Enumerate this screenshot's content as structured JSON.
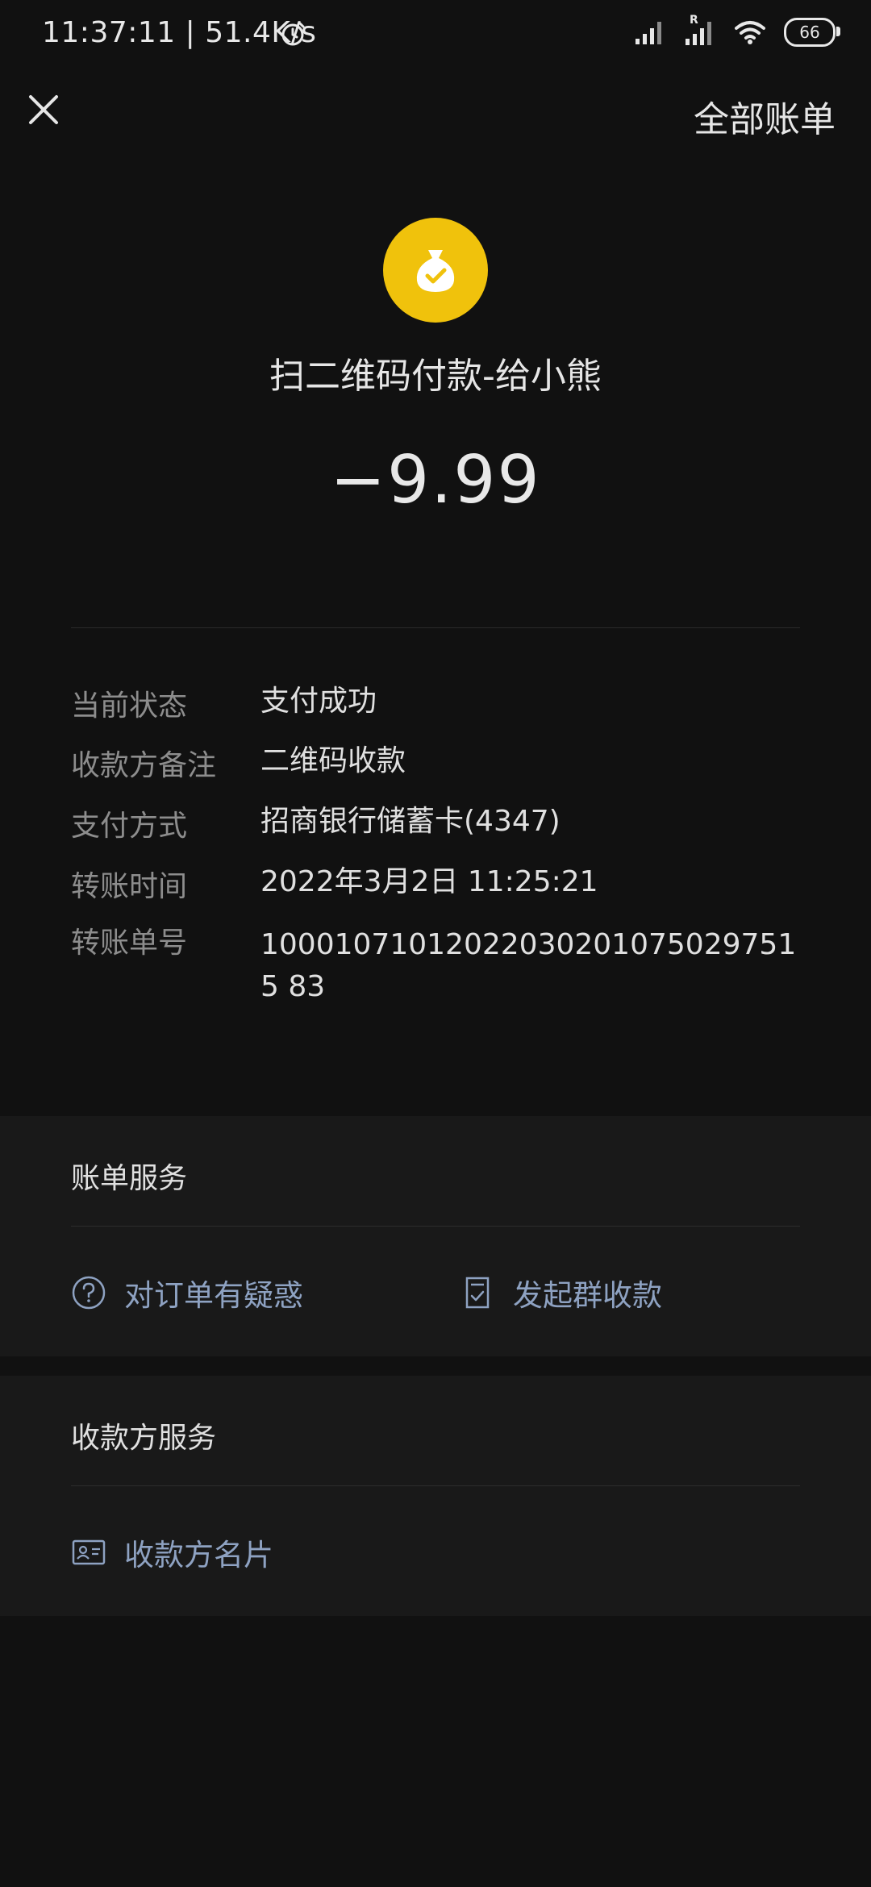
{
  "status_bar": {
    "time": "11:37:11 | 51.4K/s",
    "battery": "66",
    "roaming_mark": "R"
  },
  "nav": {
    "right_label": "全部账单"
  },
  "header": {
    "title": "扫二维码付款-给小熊",
    "amount": "−9.99"
  },
  "details": [
    {
      "label": "当前状态",
      "value": "支付成功"
    },
    {
      "label": "收款方备注",
      "value": "二维码收款"
    },
    {
      "label": "支付方式",
      "value": "招商银行储蓄卡(4347)"
    },
    {
      "label": "转账时间",
      "value": "2022年3月2日 11:25:21"
    },
    {
      "label": "转账单号",
      "value": "100010710120220302010750297515 83"
    }
  ],
  "bill_service": {
    "title": "账单服务",
    "items": [
      {
        "label": "对订单有疑惑",
        "icon": "question-circle-icon"
      },
      {
        "label": "发起群收款",
        "icon": "receipt-check-icon"
      }
    ]
  },
  "payee_service": {
    "title": "收款方服务",
    "items": [
      {
        "label": "收款方名片",
        "icon": "contact-card-icon"
      }
    ]
  },
  "colors": {
    "background": "#111111",
    "panel": "#191919",
    "accent_link": "#8ea2c2",
    "avatar": "#f0c20c"
  }
}
